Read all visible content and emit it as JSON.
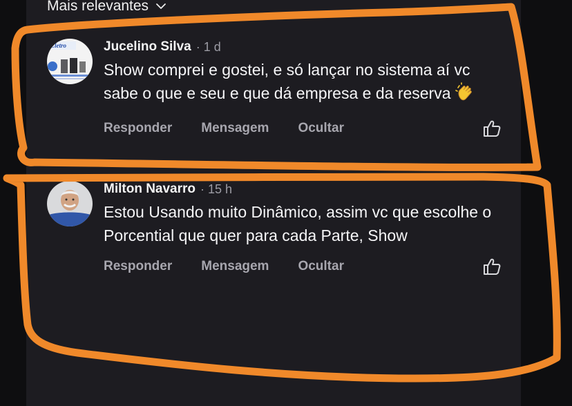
{
  "sort": {
    "label": "Mais relevantes"
  },
  "comments": [
    {
      "author": "Jucelino Silva",
      "time": "1 d",
      "text": "Show comprei e gostei, e só lançar no sistema aí vc sabe o que e seu e que dá empresa e da reserva",
      "emoji": "clapping-hands",
      "avatar_logo_text": "Eletro",
      "actions": [
        "Responder",
        "Mensagem",
        "Ocultar"
      ]
    },
    {
      "author": "Milton Navarro",
      "time": "15 h",
      "text": "Estou Usando muito Dinâmico, assim vc que escolhe o Porcential que quer para cada Parte, Show",
      "actions": [
        "Responder",
        "Mensagem",
        "Ocultar"
      ]
    }
  ],
  "colors": {
    "background": "#0e0e10",
    "panel": "#1d1c21",
    "annotation": "#f0892a",
    "muted": "#a7a6ae"
  },
  "icons": [
    "chevron-down-icon",
    "thumbs-up-icon",
    "clapping-hands-emoji"
  ]
}
